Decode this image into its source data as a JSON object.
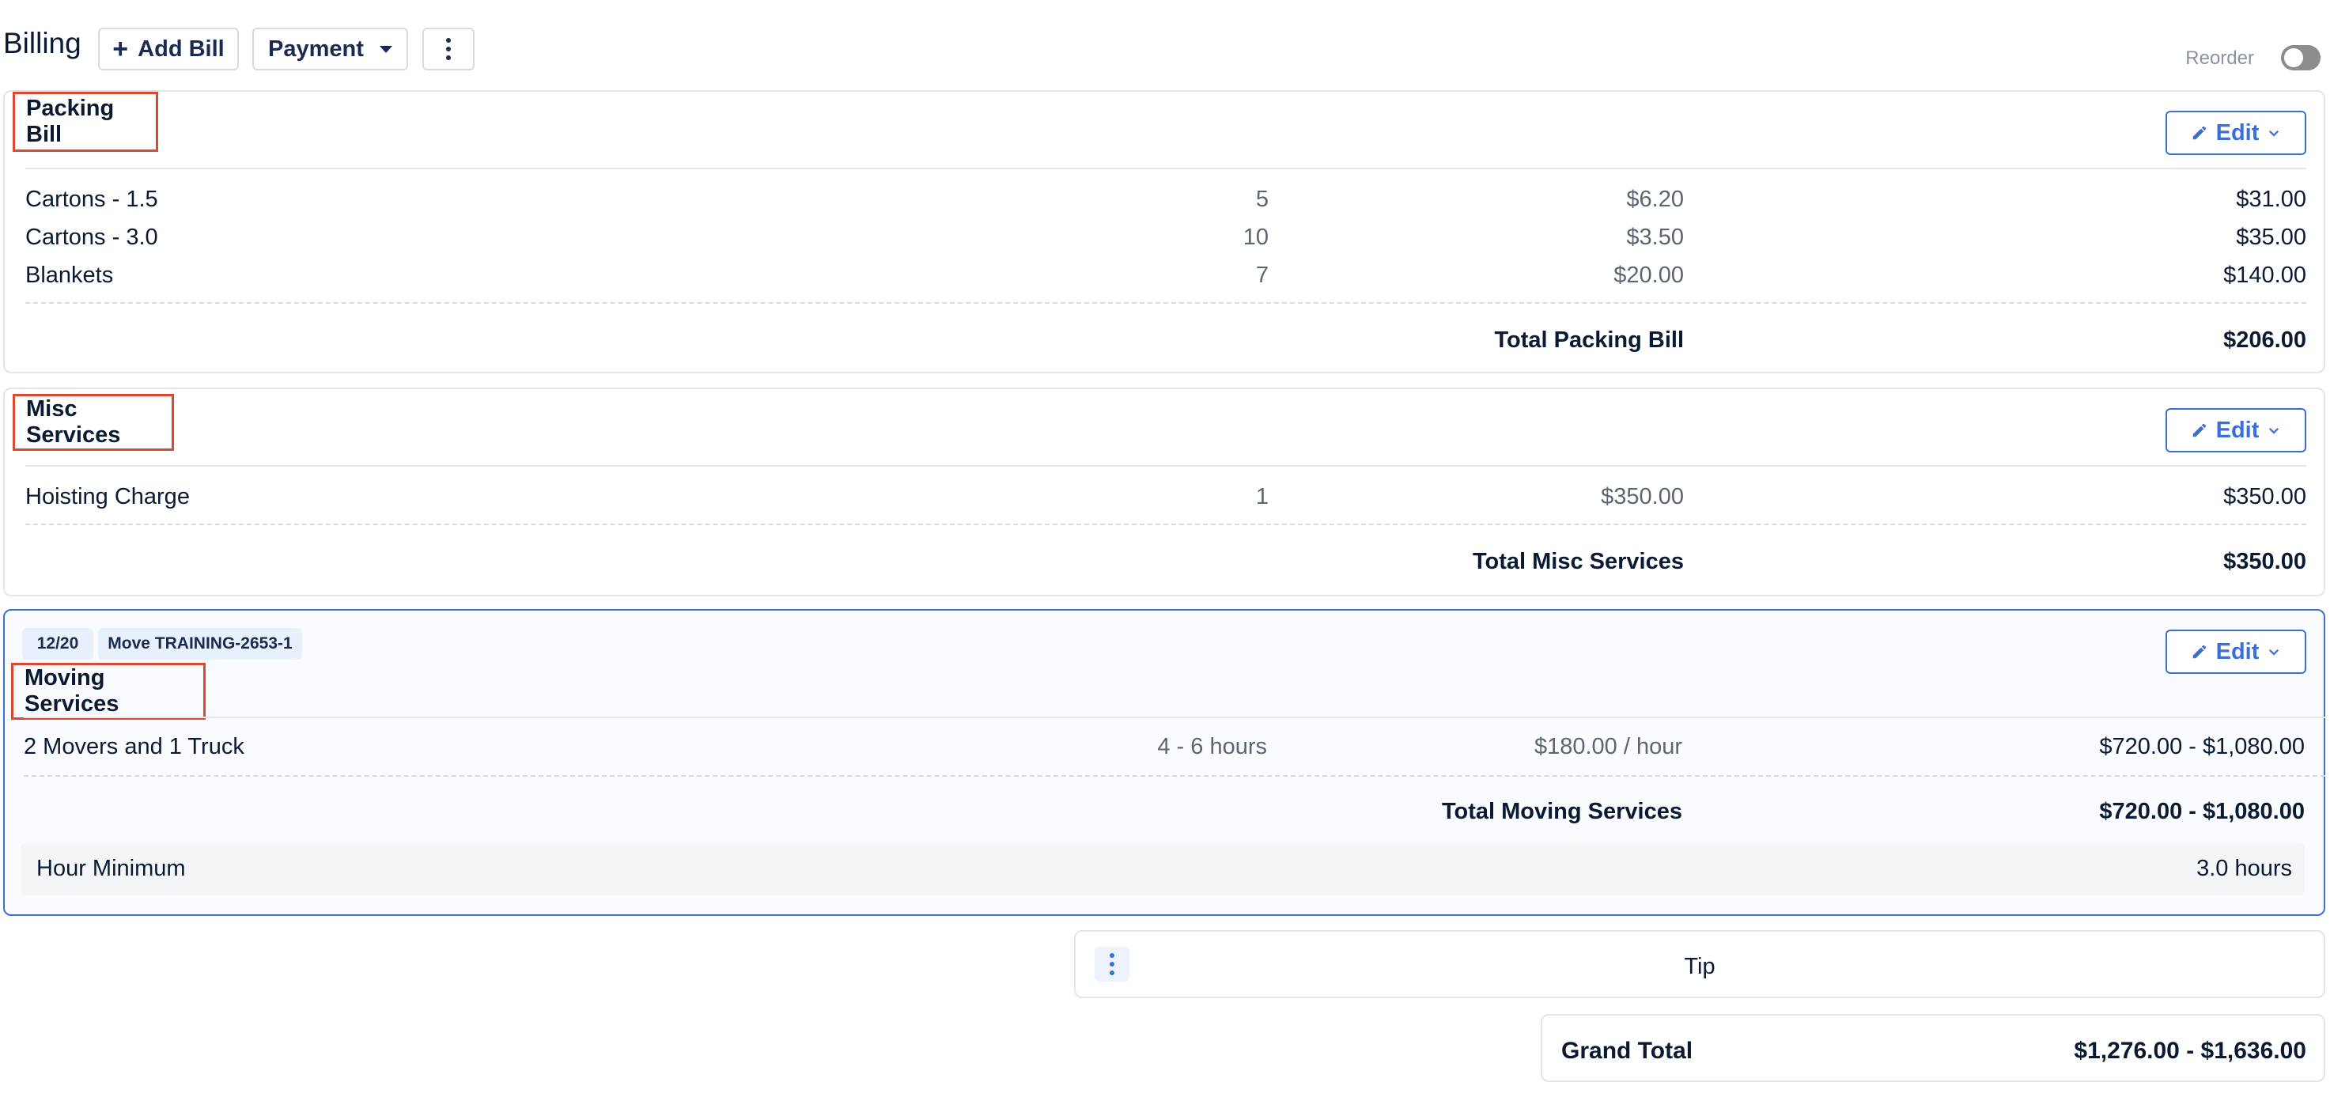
{
  "header": {
    "title": "Billing",
    "add_bill_label": "Add Bill",
    "payment_label": "Payment",
    "reorder_label": "Reorder",
    "reorder_enabled": false
  },
  "bills": [
    {
      "title": "Packing Bill",
      "edit_label": "Edit",
      "items": [
        {
          "name": "Cartons - 1.5",
          "qty": "5",
          "rate": "$6.20",
          "total": "$31.00"
        },
        {
          "name": "Cartons - 3.0",
          "qty": "10",
          "rate": "$3.50",
          "total": "$35.00"
        },
        {
          "name": "Blankets",
          "qty": "7",
          "rate": "$20.00",
          "total": "$140.00"
        }
      ],
      "total_label": "Total Packing Bill",
      "total_value": "$206.00"
    },
    {
      "title": "Misc Services",
      "edit_label": "Edit",
      "items": [
        {
          "name": "Hoisting Charge",
          "qty": "1",
          "rate": "$350.00",
          "total": "$350.00"
        }
      ],
      "total_label": "Total Misc Services",
      "total_value": "$350.00"
    },
    {
      "title": "Moving Services",
      "edit_label": "Edit",
      "badges": [
        "12/20",
        "Move TRAINING-2653-1"
      ],
      "items": [
        {
          "name": "2 Movers and 1 Truck",
          "qty": "4 - 6 hours",
          "rate": "$180.00 / hour",
          "total": "$720.00 - $1,080.00"
        }
      ],
      "total_label": "Total Moving Services",
      "total_value": "$720.00 - $1,080.00",
      "minimum_label": "Hour Minimum",
      "minimum_value": "3.0 hours"
    }
  ],
  "tip": {
    "label": "Tip"
  },
  "grand_total": {
    "label": "Grand Total",
    "value": "$1,276.00 - $1,636.00"
  },
  "colors": {
    "accent": "#3b6fd8",
    "highlight": "#d84a33",
    "text": "#0b1a33"
  }
}
